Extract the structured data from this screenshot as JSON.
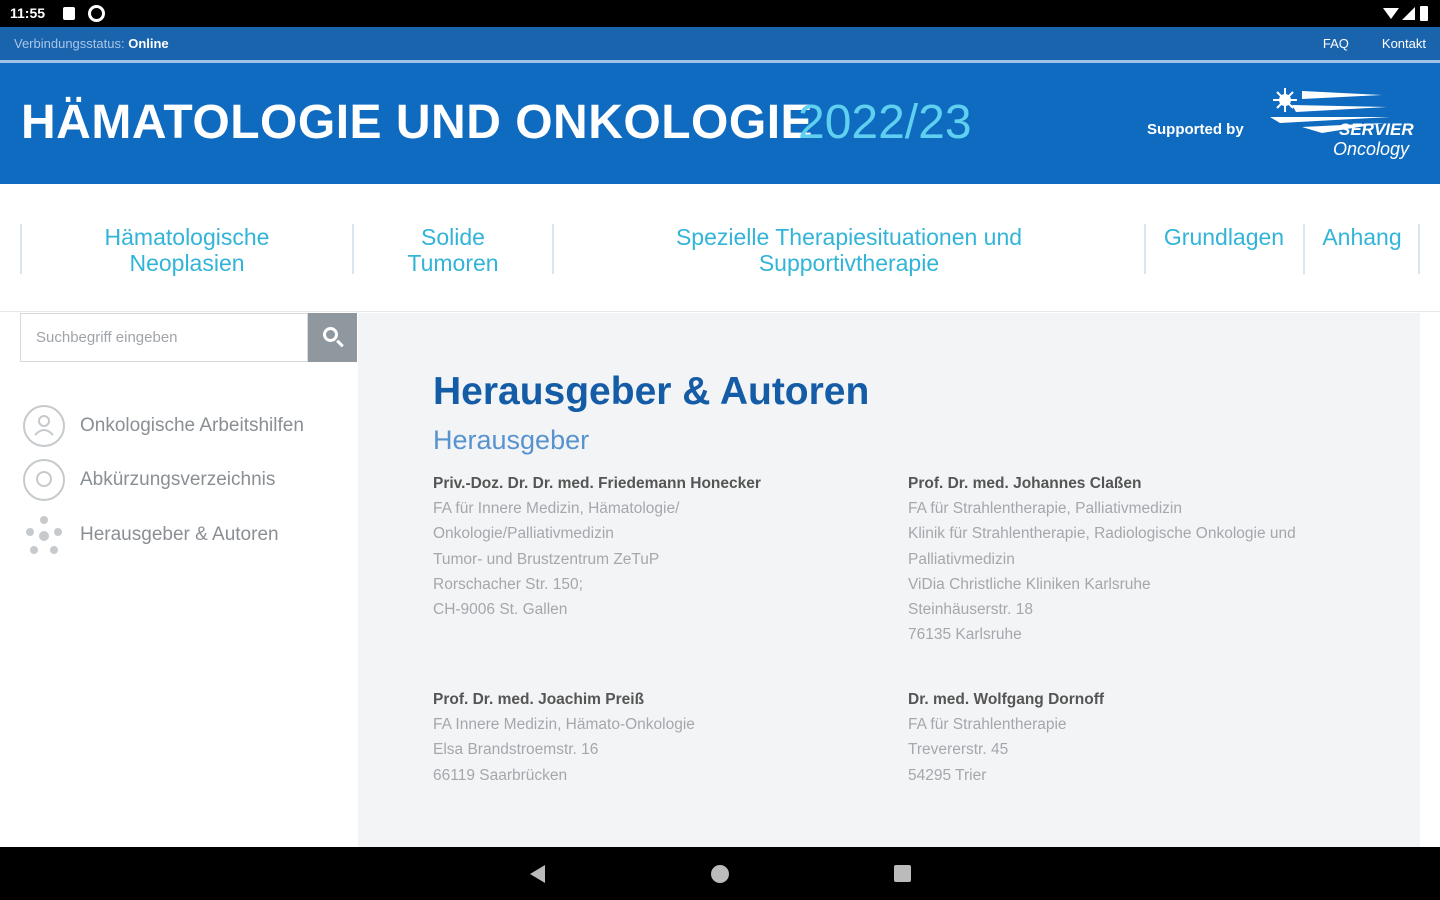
{
  "status_bar": {
    "time": "11:55"
  },
  "top_bar": {
    "connection_label": "Verbindungsstatus:",
    "connection_value": "Online",
    "links": [
      "FAQ",
      "Kontakt"
    ]
  },
  "header": {
    "title": "HÄMATOLOGIE UND ONKOLOGIE",
    "year": "2022/23",
    "supported_by": "Supported by",
    "logo_brand": "SERVIER",
    "logo_sub": "Oncology"
  },
  "nav": {
    "items": [
      {
        "line1": "Hämatologische",
        "line2": "Neoplasien"
      },
      {
        "line1": "Solide",
        "line2": "Tumoren"
      },
      {
        "line1": "Spezielle Therapiesituationen und",
        "line2": "Supportivtherapie"
      },
      {
        "line1": "Grundlagen",
        "line2": ""
      },
      {
        "line1": "Anhang",
        "line2": ""
      }
    ]
  },
  "sidebar": {
    "search_placeholder": "Suchbegriff eingeben",
    "items": [
      {
        "label": "Onkologische Arbeitshilfen",
        "icon": "person-icon"
      },
      {
        "label": "Abkürzungsverzeichnis",
        "icon": "magnifier-icon"
      },
      {
        "label": "Herausgeber & Autoren",
        "icon": "group-icon"
      }
    ]
  },
  "main": {
    "title": "Herausgeber & Autoren",
    "subtitle": "Herausgeber",
    "authors": [
      {
        "name": "Priv.-Doz. Dr. Dr. med. Friedemann Honecker",
        "lines": [
          "FA für Innere Medizin, Hämatologie/",
          "Onkologie/Palliativmedizin",
          "Tumor- und Brustzentrum ZeTuP",
          "Rorschacher Str. 150;",
          "CH-9006 St. Gallen"
        ]
      },
      {
        "name": "Prof. Dr. med. Johannes Claßen",
        "lines": [
          "FA für Strahlentherapie, Palliativmedizin",
          "Klinik für Strahlentherapie, Radiologische Onkologie und",
          "Palliativmedizin",
          "ViDia Christliche Kliniken Karlsruhe",
          "Steinhäuserstr. 18",
          "76135 Karlsruhe"
        ]
      },
      {
        "name": "Prof. Dr. med. Joachim Preiß",
        "lines": [
          "FA Innere Medizin, Hämato-Onkologie",
          "Elsa Brandstroemstr. 16",
          "66119 Saarbrücken"
        ]
      },
      {
        "name": "Dr. med. Wolfgang Dornoff",
        "lines": [
          "FA für Strahlentherapie",
          "Trevererstr. 45",
          "54295 Trier"
        ]
      }
    ]
  },
  "colors": {
    "header_blue": "#0e6bbf",
    "topbar_blue": "#1a63ad",
    "accent_cyan": "#32b4d8",
    "heading_blue": "#155ca6"
  }
}
